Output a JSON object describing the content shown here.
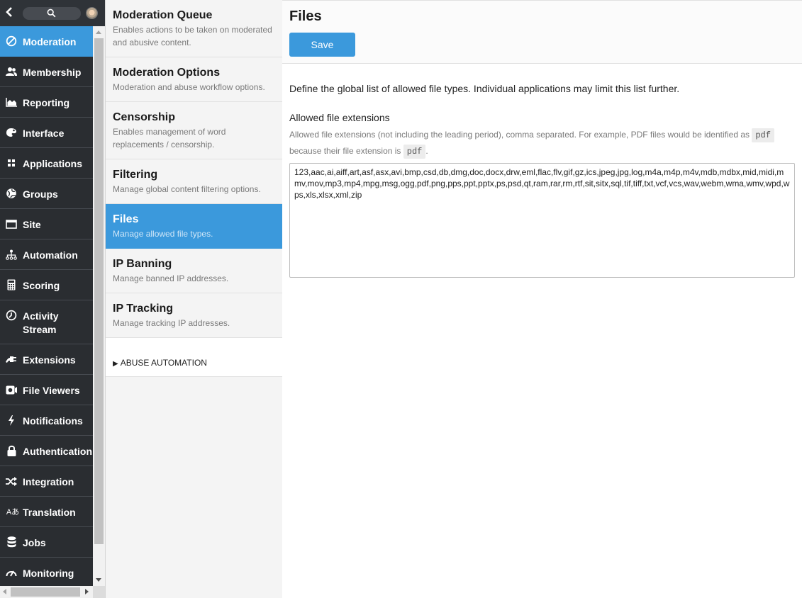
{
  "nav": {
    "back_icon": "chevron-left-icon",
    "search_icon": "search-icon",
    "avatar_icon": "user-avatar",
    "items": [
      {
        "label": "Moderation",
        "icon": "block-icon",
        "active": true
      },
      {
        "label": "Membership",
        "icon": "users-icon"
      },
      {
        "label": "Reporting",
        "icon": "area-chart-icon"
      },
      {
        "label": "Interface",
        "icon": "palette-icon"
      },
      {
        "label": "Applications",
        "icon": "grid-icon"
      },
      {
        "label": "Groups",
        "icon": "globe-icon"
      },
      {
        "label": "Site",
        "icon": "window-icon"
      },
      {
        "label": "Automation",
        "icon": "sitemap-icon"
      },
      {
        "label": "Scoring",
        "icon": "calculator-icon"
      },
      {
        "label": "Activity Stream",
        "icon": "clock-icon"
      },
      {
        "label": "Extensions",
        "icon": "plug-icon"
      },
      {
        "label": "File Viewers",
        "icon": "camera-icon"
      },
      {
        "label": "Notifications",
        "icon": "bolt-icon"
      },
      {
        "label": "Authentication",
        "icon": "lock-icon"
      },
      {
        "label": "Integration",
        "icon": "shuffle-icon"
      },
      {
        "label": "Translation",
        "icon": "language-icon"
      },
      {
        "label": "Jobs",
        "icon": "database-icon"
      },
      {
        "label": "Monitoring",
        "icon": "gauge-icon"
      }
    ]
  },
  "subnav": {
    "items": [
      {
        "title": "Moderation Queue",
        "desc": "Enables actions to be taken on moderated and abusive content."
      },
      {
        "title": "Moderation Options",
        "desc": "Moderation and abuse workflow options."
      },
      {
        "title": "Censorship",
        "desc": "Enables management of word replacements / censorship."
      },
      {
        "title": "Filtering",
        "desc": "Manage global content filtering options."
      },
      {
        "title": "Files",
        "desc": "Manage allowed file types.",
        "active": true
      },
      {
        "title": "IP Banning",
        "desc": "Manage banned IP addresses."
      },
      {
        "title": "IP Tracking",
        "desc": "Manage tracking IP addresses."
      }
    ],
    "collapsible": {
      "label": "ABUSE AUTOMATION",
      "expanded": false
    }
  },
  "main": {
    "title": "Files",
    "save_label": "Save",
    "intro": "Define the global list of allowed file types. Individual applications may limit this list further.",
    "field": {
      "label": "Allowed file extensions",
      "help_part1": "Allowed file extensions (not including the leading period), comma separated. For example, PDF files would be identified as ",
      "help_code1": "pdf",
      "help_part2": " because their file extension is ",
      "help_code2": "pdf",
      "help_part3": ".",
      "value": "123,aac,ai,aiff,art,asf,asx,avi,bmp,csd,db,dmg,doc,docx,drw,eml,flac,flv,gif,gz,ics,jpeg,jpg,log,m4a,m4p,m4v,mdb,mdbx,mid,midi,mmv,mov,mp3,mp4,mpg,msg,ogg,pdf,png,pps,ppt,pptx,ps,psd,qt,ram,rar,rm,rtf,sit,sitx,sql,tif,tiff,txt,vcf,vcs,wav,webm,wma,wmv,wpd,wps,xls,xlsx,xml,zip"
    }
  },
  "colors": {
    "accent": "#3b99dc",
    "nav_bg": "#2a2d31",
    "subnav_bg": "#f4f4f4"
  }
}
